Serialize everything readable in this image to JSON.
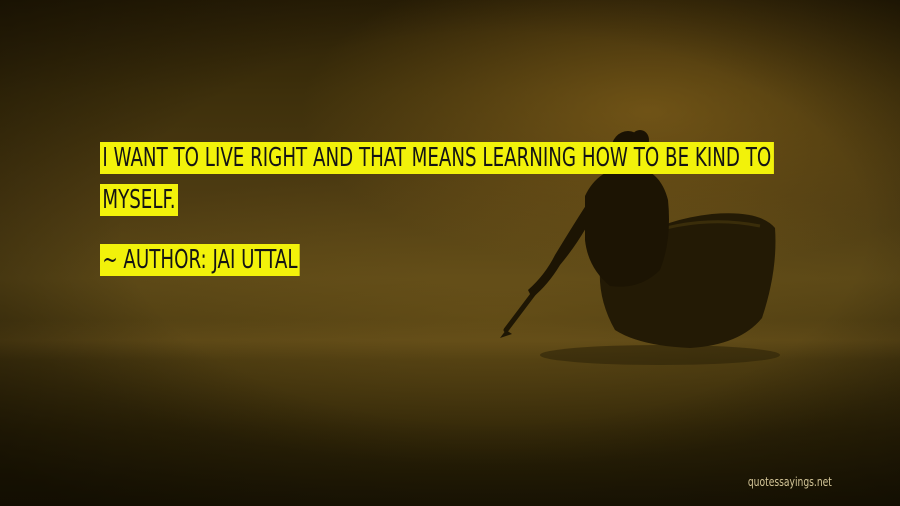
{
  "quote": {
    "line1": "I WANT TO LIVE RIGHT AND THAT MEANS LEARNING HOW TO BE KIND TO",
    "line2": "MYSELF.",
    "author_line": "~ AUTHOR: JAI UTTAL"
  },
  "watermark": "quotessayings.net",
  "colors": {
    "highlight": "#f2f20a",
    "text": "#141414",
    "scene_dark": "#2a1f06",
    "scene_mid": "#5a4716"
  }
}
